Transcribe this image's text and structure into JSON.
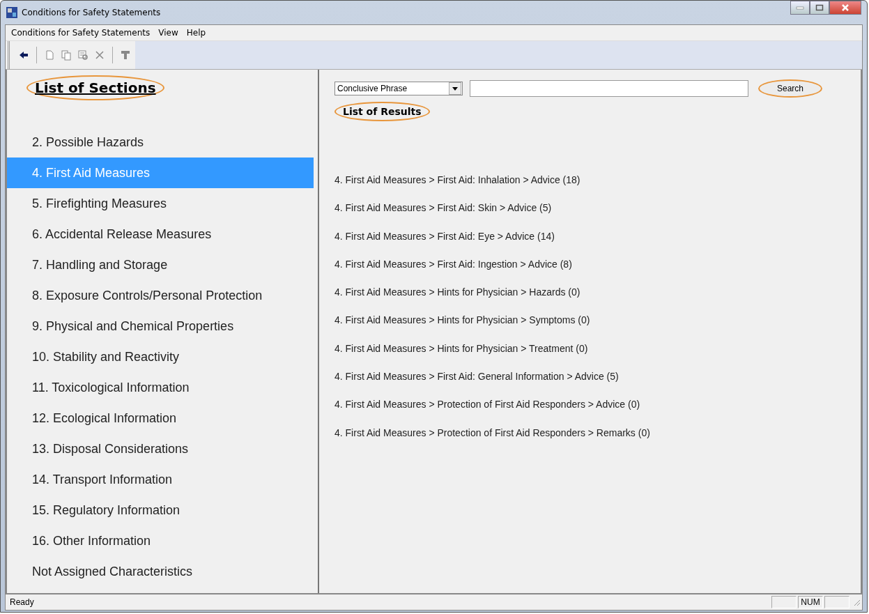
{
  "window": {
    "title": "Conditions for Safety Statements"
  },
  "menu": [
    "Conditions for Safety Statements",
    "View",
    "Help"
  ],
  "toolbar": [
    {
      "kind": "back",
      "disabled": false
    },
    {
      "kind": "sep"
    },
    {
      "kind": "new",
      "disabled": true
    },
    {
      "kind": "copy",
      "disabled": true
    },
    {
      "kind": "find",
      "disabled": true
    },
    {
      "kind": "delete",
      "disabled": true
    },
    {
      "kind": "sep"
    },
    {
      "kind": "filter",
      "disabled": true
    }
  ],
  "sections": {
    "title": "List of Sections",
    "items": [
      {
        "label": "2. Possible Hazards",
        "selected": false
      },
      {
        "label": "4. First Aid Measures",
        "selected": true
      },
      {
        "label": "5. Firefighting Measures",
        "selected": false
      },
      {
        "label": "6. Accidental Release Measures",
        "selected": false
      },
      {
        "label": "7. Handling and Storage",
        "selected": false
      },
      {
        "label": "8. Exposure Controls/Personal Protection",
        "selected": false
      },
      {
        "label": "9. Physical and Chemical Properties",
        "selected": false
      },
      {
        "label": "10. Stability and Reactivity",
        "selected": false
      },
      {
        "label": "11. Toxicological Information",
        "selected": false
      },
      {
        "label": "12. Ecological Information",
        "selected": false
      },
      {
        "label": "13. Disposal Considerations",
        "selected": false
      },
      {
        "label": "14. Transport Information",
        "selected": false
      },
      {
        "label": "15. Regulatory Information",
        "selected": false
      },
      {
        "label": "16. Other Information",
        "selected": false
      },
      {
        "label": "Not Assigned Characteristics",
        "selected": false
      }
    ]
  },
  "search": {
    "mode": "Conclusive Phrase",
    "button": "Search"
  },
  "results": {
    "title": "List of Results",
    "items": [
      "4. First Aid Measures > First Aid: Inhalation > Advice (18)",
      "4. First Aid Measures > First Aid: Skin > Advice (5)",
      "4. First Aid Measures > First Aid: Eye > Advice (14)",
      "4. First Aid Measures > First Aid: Ingestion > Advice (8)",
      "4. First Aid Measures > Hints for Physician > Hazards (0)",
      "4. First Aid Measures > Hints for Physician > Symptoms (0)",
      "4. First Aid Measures > Hints for Physician > Treatment (0)",
      "4. First Aid Measures > First Aid: General Information > Advice (5)",
      "4. First Aid Measures > Protection of First Aid Responders > Advice (0)",
      "4. First Aid Measures > Protection of First Aid Responders > Remarks (0)"
    ]
  },
  "status_bar": {
    "text": "Ready",
    "indicator": "NUM"
  }
}
